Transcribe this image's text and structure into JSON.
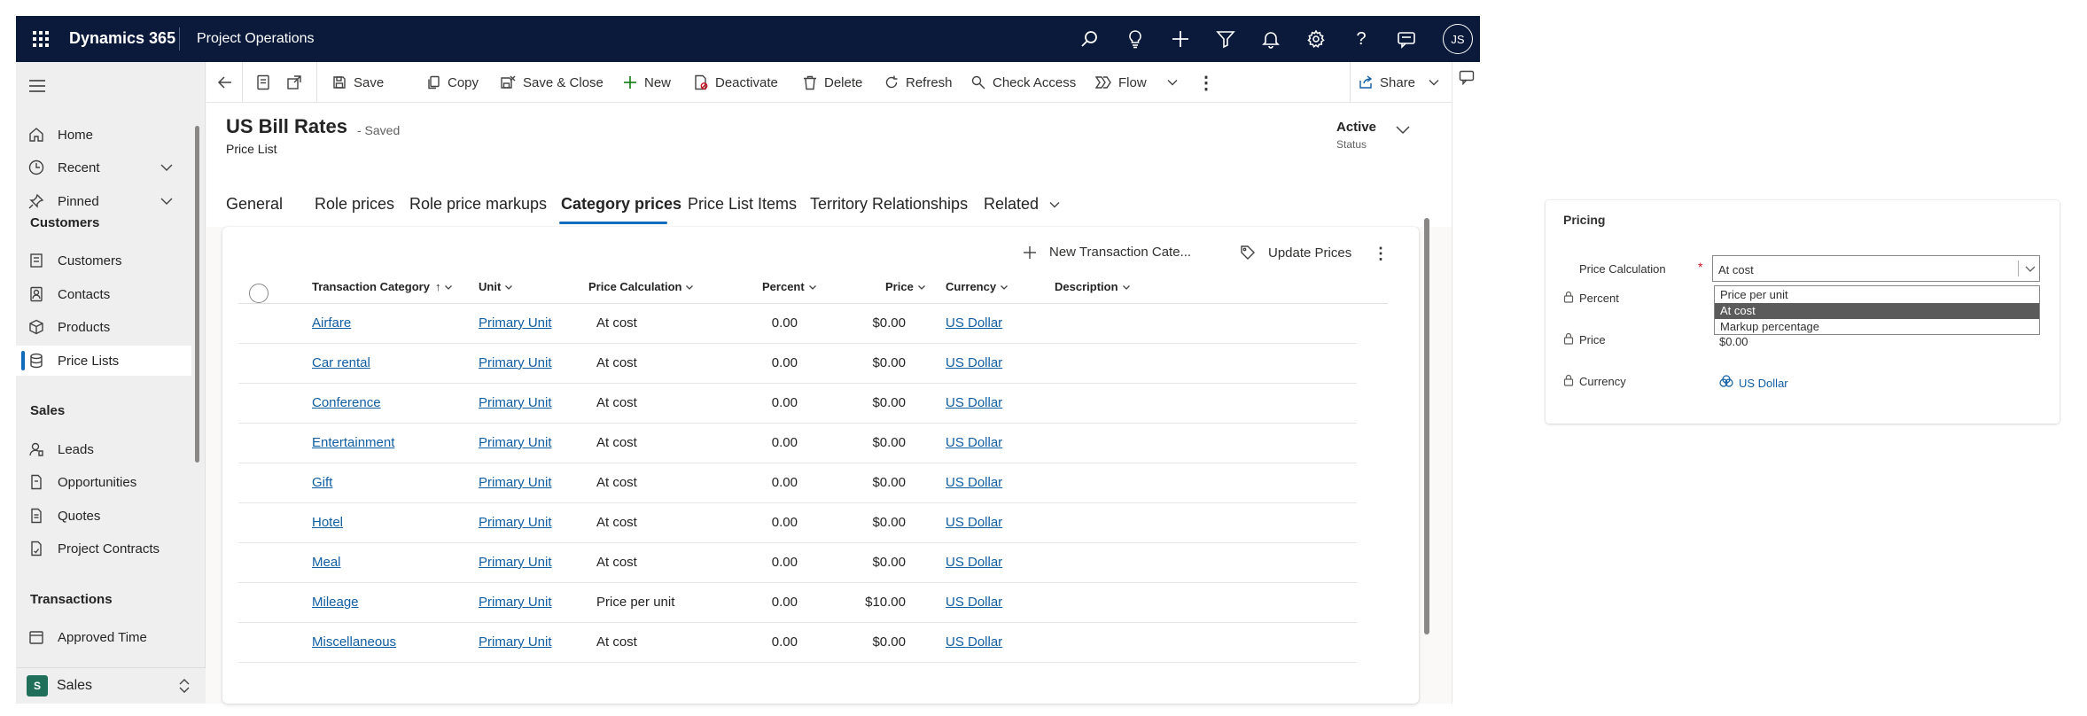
{
  "topbar": {
    "brand": "Dynamics 365",
    "app_name": "Project Operations",
    "avatar_initials": "JS",
    "icons": [
      "search-icon",
      "lightbulb-icon",
      "plus-icon",
      "filter-icon",
      "bell-icon",
      "gear-icon",
      "help-icon",
      "chat-icon"
    ]
  },
  "sidebar": {
    "items_top": [
      {
        "label": "Home",
        "icon": "home-icon"
      },
      {
        "label": "Recent",
        "icon": "clock-icon"
      },
      {
        "label": "Pinned",
        "icon": "pin-icon"
      }
    ],
    "groups": [
      {
        "title": "Customers",
        "items": [
          "Customers",
          "Contacts",
          "Products",
          "Price Lists"
        ]
      },
      {
        "title": "Sales",
        "items": [
          "Leads",
          "Opportunities",
          "Quotes",
          "Project Contracts"
        ]
      },
      {
        "title": "Transactions",
        "items": [
          "Approved Time"
        ]
      }
    ],
    "active_item": "Price Lists",
    "area_initial": "S",
    "area_label": "Sales"
  },
  "commandbar": {
    "save": "Save",
    "copy": "Copy",
    "save_close": "Save & Close",
    "new": "New",
    "deactivate": "Deactivate",
    "delete": "Delete",
    "refresh": "Refresh",
    "check_access": "Check Access",
    "flow": "Flow",
    "share": "Share"
  },
  "record": {
    "title": "US Bill Rates",
    "saved_state": "- Saved",
    "entity": "Price List",
    "status_value": "Active",
    "status_label": "Status"
  },
  "tabs": [
    "General",
    "Role prices",
    "Role price markups",
    "Category prices",
    "Price List Items",
    "Territory Relationships",
    "Related"
  ],
  "active_tab": "Category prices",
  "grid": {
    "commands": {
      "new": "New Transaction Cate...",
      "update": "Update Prices"
    },
    "columns": [
      "Transaction Category",
      "Unit",
      "Price Calculation",
      "Percent",
      "Price",
      "Currency",
      "Description"
    ],
    "sort_indicator": "↑",
    "rows": [
      {
        "category": "Airfare",
        "unit": "Primary Unit",
        "calc": "At cost",
        "percent": "0.00",
        "price": "$0.00",
        "currency": "US Dollar"
      },
      {
        "category": "Car rental",
        "unit": "Primary Unit",
        "calc": "At cost",
        "percent": "0.00",
        "price": "$0.00",
        "currency": "US Dollar"
      },
      {
        "category": "Conference",
        "unit": "Primary Unit",
        "calc": "At cost",
        "percent": "0.00",
        "price": "$0.00",
        "currency": "US Dollar"
      },
      {
        "category": "Entertainment",
        "unit": "Primary Unit",
        "calc": "At cost",
        "percent": "0.00",
        "price": "$0.00",
        "currency": "US Dollar"
      },
      {
        "category": "Gift",
        "unit": "Primary Unit",
        "calc": "At cost",
        "percent": "0.00",
        "price": "$0.00",
        "currency": "US Dollar"
      },
      {
        "category": "Hotel",
        "unit": "Primary Unit",
        "calc": "At cost",
        "percent": "0.00",
        "price": "$0.00",
        "currency": "US Dollar"
      },
      {
        "category": "Meal",
        "unit": "Primary Unit",
        "calc": "At cost",
        "percent": "0.00",
        "price": "$0.00",
        "currency": "US Dollar"
      },
      {
        "category": "Mileage",
        "unit": "Primary Unit",
        "calc": "Price per unit",
        "percent": "0.00",
        "price": "$10.00",
        "currency": "US Dollar"
      },
      {
        "category": "Miscellaneous",
        "unit": "Primary Unit",
        "calc": "At cost",
        "percent": "0.00",
        "price": "$0.00",
        "currency": "US Dollar"
      }
    ]
  },
  "pricing_panel": {
    "title": "Pricing",
    "price_calc_label": "Price Calculation",
    "required_mark": "*",
    "price_calc_value": "At cost",
    "options": [
      "Price per unit",
      "At cost",
      "Markup percentage"
    ],
    "selected_option": "At cost",
    "percent_label": "Percent",
    "price_label": "Price",
    "price_value": "$0.00",
    "currency_label": "Currency",
    "currency_value": "US Dollar"
  },
  "colors": {
    "topbar": "#0b1a3a",
    "accent": "#0f6cbd",
    "link": "#115ea3",
    "area_tile": "#1f6f5a"
  }
}
